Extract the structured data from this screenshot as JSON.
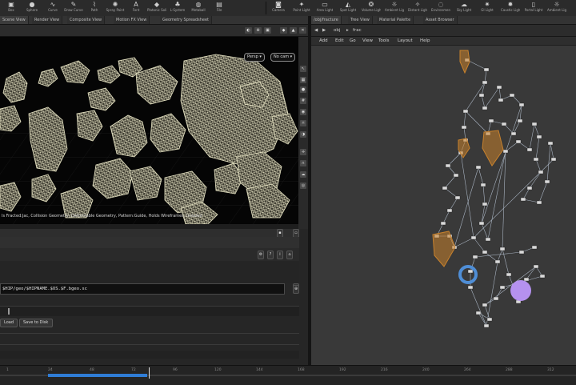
{
  "shelf": {
    "left_tools": [
      {
        "icon": "box",
        "label": "Box"
      },
      {
        "icon": "sphere",
        "label": "Sphere"
      },
      {
        "icon": "curve",
        "label": "Curve"
      },
      {
        "icon": "draw-curve",
        "label": "Draw Curve"
      },
      {
        "icon": "path",
        "label": "Path"
      },
      {
        "icon": "spray-paint",
        "label": "Spray Paint"
      },
      {
        "icon": "font",
        "label": "Font"
      },
      {
        "icon": "platonic",
        "label": "Platonic Solids"
      },
      {
        "icon": "l-system",
        "label": "L-System"
      },
      {
        "icon": "metaball",
        "label": "Metaball"
      },
      {
        "icon": "file",
        "label": "File"
      }
    ],
    "right_tools": [
      {
        "icon": "camera",
        "label": "Camera"
      },
      {
        "icon": "point-light",
        "label": "Point Light"
      },
      {
        "icon": "area-light",
        "label": "Area Light"
      },
      {
        "icon": "spot-light",
        "label": "Spot Light"
      },
      {
        "icon": "volume-light",
        "label": "Volume Light"
      },
      {
        "icon": "ambient-light",
        "label": "Ambient Light"
      },
      {
        "icon": "distant-light",
        "label": "Distant Light"
      },
      {
        "icon": "env-light",
        "label": "Environment Light"
      },
      {
        "icon": "sky-light",
        "label": "Sky Light"
      },
      {
        "icon": "gi-light",
        "label": "GI Light"
      },
      {
        "icon": "caustic-light",
        "label": "Caustic Light"
      },
      {
        "icon": "portal-light",
        "label": "Portal Light"
      },
      {
        "icon": "ambient-light-2",
        "label": "Ambient Light"
      }
    ]
  },
  "left_tabs": [
    "Scene View",
    "Render View",
    "Composite View",
    "Motion FX View",
    "Geometry Spreadsheet"
  ],
  "viewport": {
    "persp_menu": "Persp ▾",
    "cam_menu": "No cam ▾",
    "status_text": "Is Fracted:Jac, Collision Geometry, Deformable Geometry, Pattern:Guide, Holds Wireframes, Isolated"
  },
  "params": {
    "path_value": "$HIP/geo/$HIPNAME.$OS.$F.bgeo.sc",
    "bottom_button_left": "Load",
    "bottom_button_right": "Save to Disk"
  },
  "right_tabs": [
    "/obj/fracture",
    "Tree View",
    "Material Palette",
    "Asset Browser"
  ],
  "net_path": {
    "obj": "obj",
    "node": "frac"
  },
  "net_menu": [
    "Add",
    "Edit",
    "Go",
    "View",
    "Tools",
    "Layout",
    "Help"
  ],
  "timeline": {
    "ticks": [
      "1",
      "24",
      "48",
      "72",
      "96",
      "120",
      "144",
      "168",
      "192",
      "216",
      "240",
      "264",
      "288",
      "312"
    ],
    "current_frame": "48"
  },
  "colors": {
    "accent_blue": "#2f7dd6",
    "orange_node": "#c9822c",
    "purple_node": "#b591ef",
    "blue_ring": "#4f8ed6",
    "wire": "#e6e3c3"
  }
}
